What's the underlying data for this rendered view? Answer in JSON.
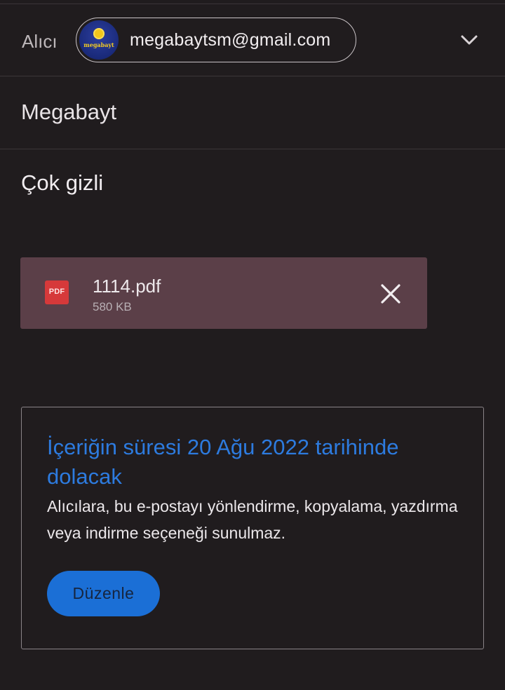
{
  "compose": {
    "to": {
      "label": "Alıcı",
      "recipient_email": "megabaytsm@gmail.com",
      "avatar_text": "megabayt",
      "expand_icon": "chevron-down-icon"
    },
    "from": {
      "value": "Megabayt"
    },
    "subject": {
      "value": "Çok gizli"
    },
    "attachment": {
      "icon_text": "PDF",
      "file_name": "1114.pdf",
      "file_size": "580 KB",
      "remove_icon": "close-icon"
    },
    "confidential_mode": {
      "title": "İçeriğin süresi 20 Ağu 2022 tarihinde dolacak",
      "description": "Alıcılara, bu e-postayı yönlendirme, kopyalama, yazdırma veya indirme seçeneği sunulmaz.",
      "edit_button_label": "Düzenle"
    }
  },
  "colors": {
    "background": "#201c1e",
    "accent_blue": "#2d7bdf",
    "button_blue": "#1b6fd6",
    "attachment_bg": "#5b3f48",
    "pdf_red": "#d6393a"
  }
}
